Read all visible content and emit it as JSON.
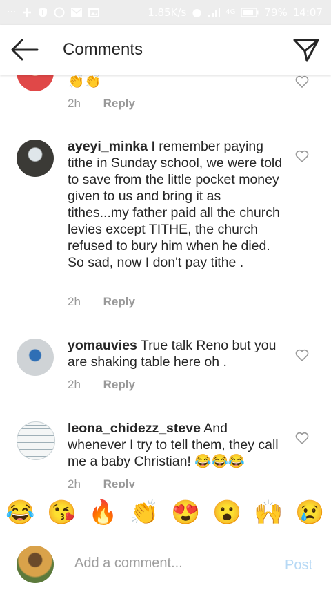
{
  "status_bar": {
    "network_speed": "1.85K/s",
    "signal_label": "4G",
    "battery": "79%",
    "time": "14:07",
    "dots": "···"
  },
  "header": {
    "title": "Comments"
  },
  "comments": [
    {
      "username": "",
      "text": "",
      "emoji": "👏👏",
      "time": "2h",
      "reply": "Reply"
    },
    {
      "username": "ayeyi_minka",
      "text": " I remember paying tithe in Sunday school, we were told to save from the little pocket money given to us and bring it as tithes...my father paid all the church levies except TITHE,  the church refused to bury him when he died. So sad, now I don't pay tithe .",
      "time": "2h",
      "reply": "Reply"
    },
    {
      "username": "yomauvies",
      "text": " True talk Reno but you are shaking table here oh .",
      "time": "2h",
      "reply": "Reply"
    },
    {
      "username": "leona_chidezz_steve",
      "text": " And whenever I try to tell them, they call me a baby Christian! 😂😂😂",
      "time": "2h",
      "reply": "Reply"
    }
  ],
  "emoji_bar": [
    {
      "glyph": "😂",
      "icon": "tears-of-joy"
    },
    {
      "glyph": "😘",
      "icon": "kissing-face"
    },
    {
      "glyph": "🔥",
      "icon": "fire"
    },
    {
      "glyph": "👏",
      "icon": "clapping-hands"
    },
    {
      "glyph": "😍",
      "icon": "heart-eyes"
    },
    {
      "glyph": "😮",
      "icon": "surprised-face"
    },
    {
      "glyph": "🙌",
      "icon": "raised-hands"
    },
    {
      "glyph": "😢",
      "icon": "crying-face"
    }
  ],
  "composer": {
    "placeholder": "Add a comment...",
    "post_label": "Post"
  },
  "colors": {
    "link_blue": "#b7d9f5",
    "text": "#262626",
    "muted": "#999999"
  }
}
